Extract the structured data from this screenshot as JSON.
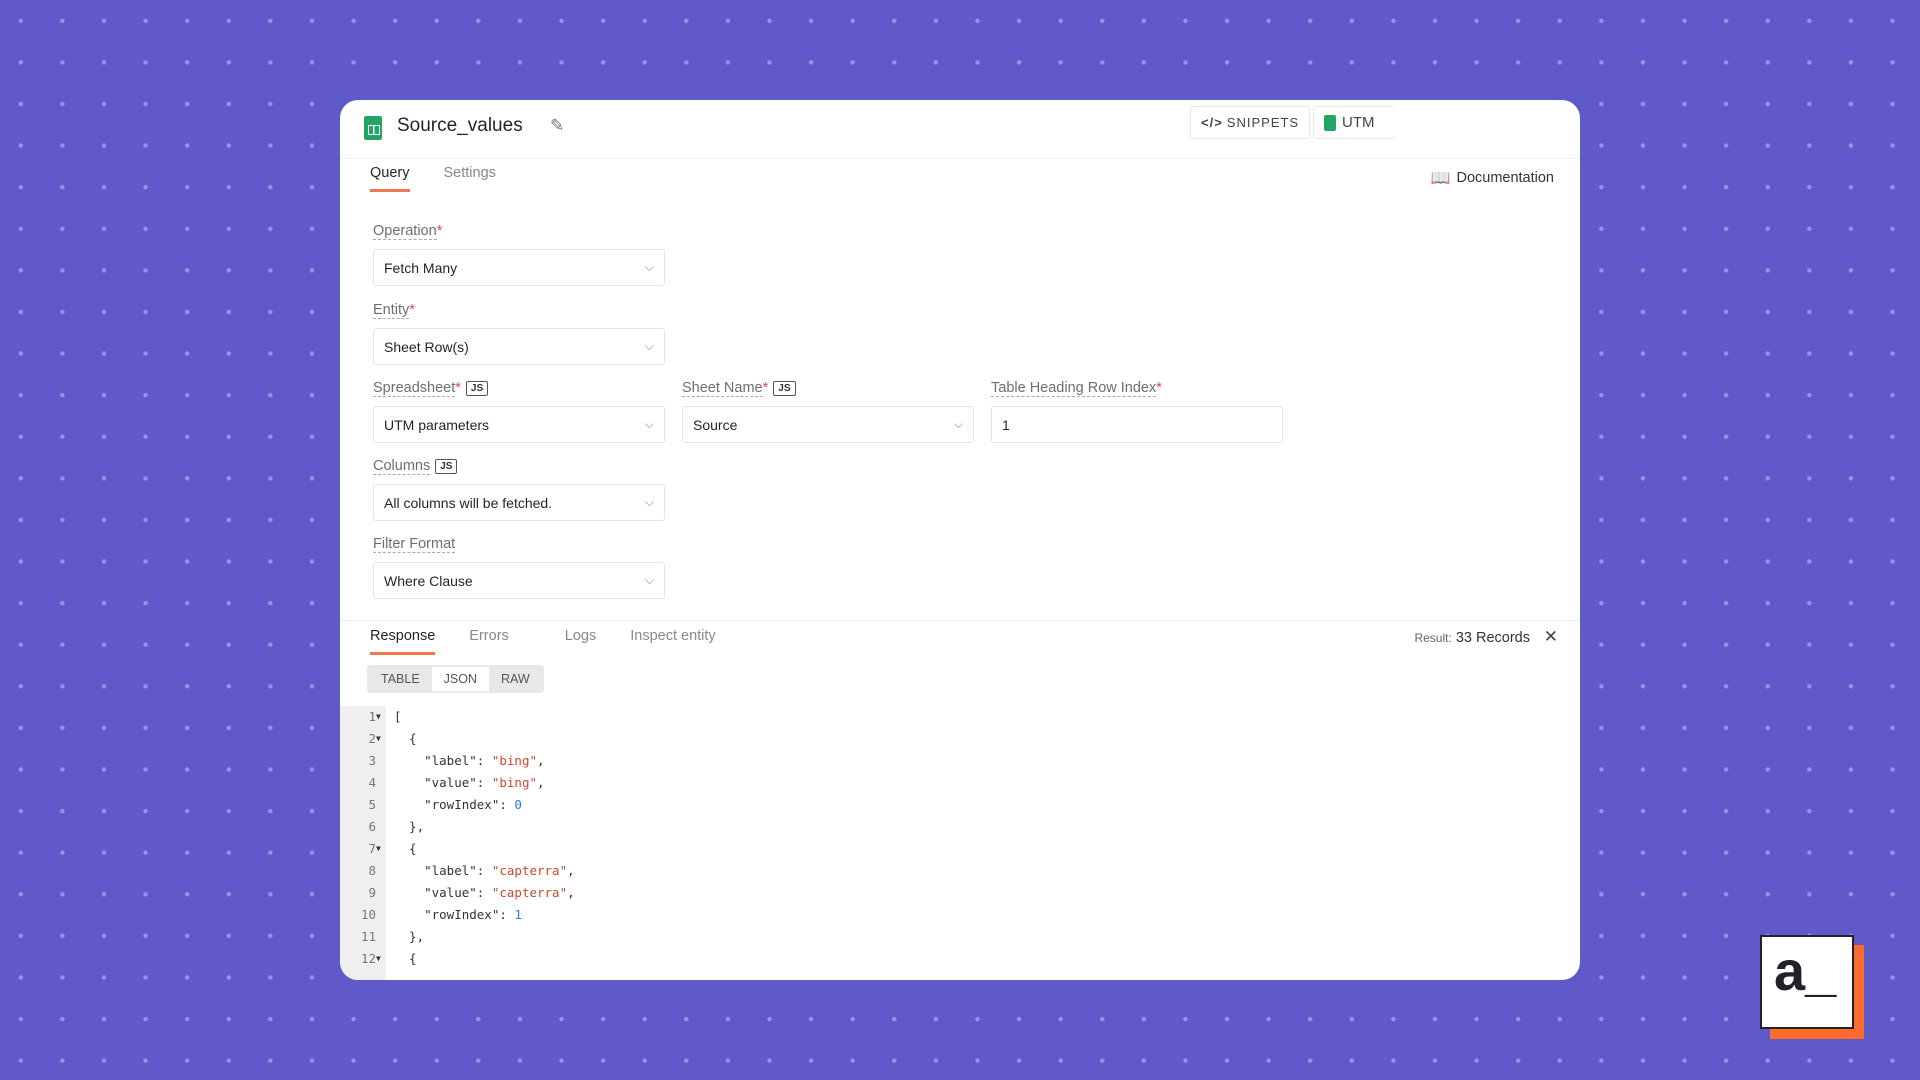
{
  "header": {
    "title": "Source_values",
    "snippets_label": "SNIPPETS",
    "datasource_label": "UTM"
  },
  "tabs": [
    {
      "label": "Query"
    },
    {
      "label": "Settings"
    }
  ],
  "documentation_label": "Documentation",
  "fields": {
    "operation": {
      "label": "Operation",
      "value": "Fetch Many"
    },
    "entity": {
      "label": "Entity",
      "value": "Sheet Row(s)"
    },
    "spreadsheet": {
      "label": "Spreadsheet",
      "value": "UTM parameters",
      "js": "JS"
    },
    "sheet_name": {
      "label": "Sheet Name",
      "value": "Source",
      "js": "JS"
    },
    "table_heading": {
      "label": "Table Heading Row Index",
      "value": "1"
    },
    "columns": {
      "label": "Columns",
      "value": "All columns will be fetched.",
      "js": "JS"
    },
    "filter_format": {
      "label": "Filter Format",
      "value": "Where Clause"
    }
  },
  "response": {
    "tabs": [
      "Response",
      "Errors",
      "Logs",
      "Inspect entity"
    ],
    "result_label": "Result:",
    "result_value": "33 Records",
    "views": [
      "TABLE",
      "JSON",
      "RAW"
    ],
    "active_view": "JSON"
  },
  "code_lines": [
    {
      "n": "1",
      "fold": true,
      "parts": [
        [
          "p",
          "["
        ]
      ]
    },
    {
      "n": "2",
      "fold": true,
      "parts": [
        [
          "p",
          "  {"
        ]
      ]
    },
    {
      "n": "3",
      "parts": [
        [
          "p",
          "    \"label\": "
        ],
        [
          "s",
          "\"bing\""
        ],
        [
          "p",
          ","
        ]
      ]
    },
    {
      "n": "4",
      "parts": [
        [
          "p",
          "    \"value\": "
        ],
        [
          "s",
          "\"bing\""
        ],
        [
          "p",
          ","
        ]
      ]
    },
    {
      "n": "5",
      "parts": [
        [
          "p",
          "    \"rowIndex\": "
        ],
        [
          "n",
          "0"
        ]
      ]
    },
    {
      "n": "6",
      "parts": [
        [
          "p",
          "  },"
        ]
      ]
    },
    {
      "n": "7",
      "fold": true,
      "parts": [
        [
          "p",
          "  {"
        ]
      ]
    },
    {
      "n": "8",
      "parts": [
        [
          "p",
          "    \"label\": "
        ],
        [
          "s",
          "\"capterra\""
        ],
        [
          "p",
          ","
        ]
      ]
    },
    {
      "n": "9",
      "parts": [
        [
          "p",
          "    \"value\": "
        ],
        [
          "s",
          "\"capterra\""
        ],
        [
          "p",
          ","
        ]
      ]
    },
    {
      "n": "10",
      "parts": [
        [
          "p",
          "    \"rowIndex\": "
        ],
        [
          "n",
          "1"
        ]
      ]
    },
    {
      "n": "11",
      "parts": [
        [
          "p",
          "  },"
        ]
      ]
    },
    {
      "n": "12",
      "fold": true,
      "parts": [
        [
          "p",
          "  {"
        ]
      ]
    }
  ],
  "logo_text": "a_",
  "colors": {
    "background": "#5f59c9",
    "accent": "#f07a50",
    "logo_shadow": "#ff6b2c"
  }
}
